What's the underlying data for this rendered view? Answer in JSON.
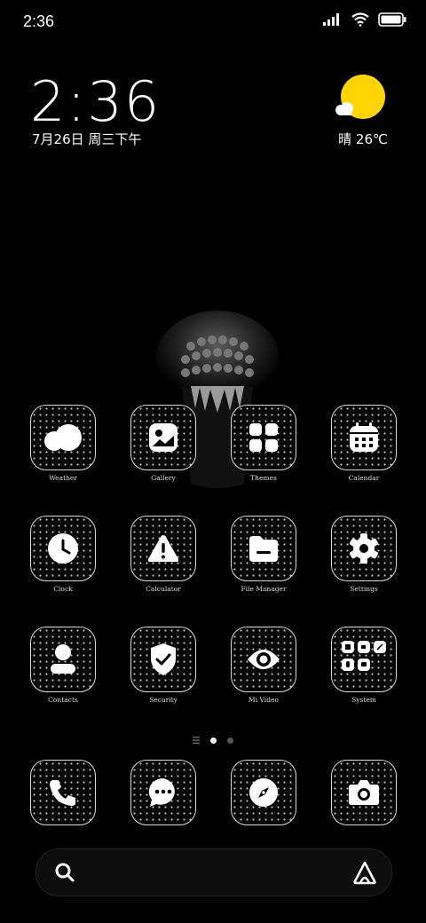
{
  "status_bar": {
    "time": "2:36"
  },
  "clock_widget": {
    "time": "2:36",
    "date": "7月26日 周三下午"
  },
  "weather_widget": {
    "text": "晴 26℃",
    "sun_color": "#ffd400"
  },
  "apps": [
    {
      "label": "Weather",
      "icon": "cloud-icon"
    },
    {
      "label": "Gallery",
      "icon": "image-icon"
    },
    {
      "label": "Themes",
      "icon": "grid-icon"
    },
    {
      "label": "Calendar",
      "icon": "calendar-icon"
    },
    {
      "label": "Clock",
      "icon": "clock-icon"
    },
    {
      "label": "Calculator",
      "icon": "warning-icon"
    },
    {
      "label": "File Manager",
      "icon": "folder-icon"
    },
    {
      "label": "Settings",
      "icon": "gear-icon"
    },
    {
      "label": "Contacts",
      "icon": "person-icon"
    },
    {
      "label": "Security",
      "icon": "shield-icon"
    },
    {
      "label": "Mi Video",
      "icon": "eye-icon"
    },
    {
      "label": "System",
      "icon": "folder-grid-icon"
    }
  ],
  "dock": [
    {
      "icon": "phone-icon"
    },
    {
      "icon": "message-icon"
    },
    {
      "icon": "compass-icon"
    },
    {
      "icon": "camera-icon"
    }
  ],
  "page_indicator": {
    "pages": 2,
    "current": 1
  }
}
